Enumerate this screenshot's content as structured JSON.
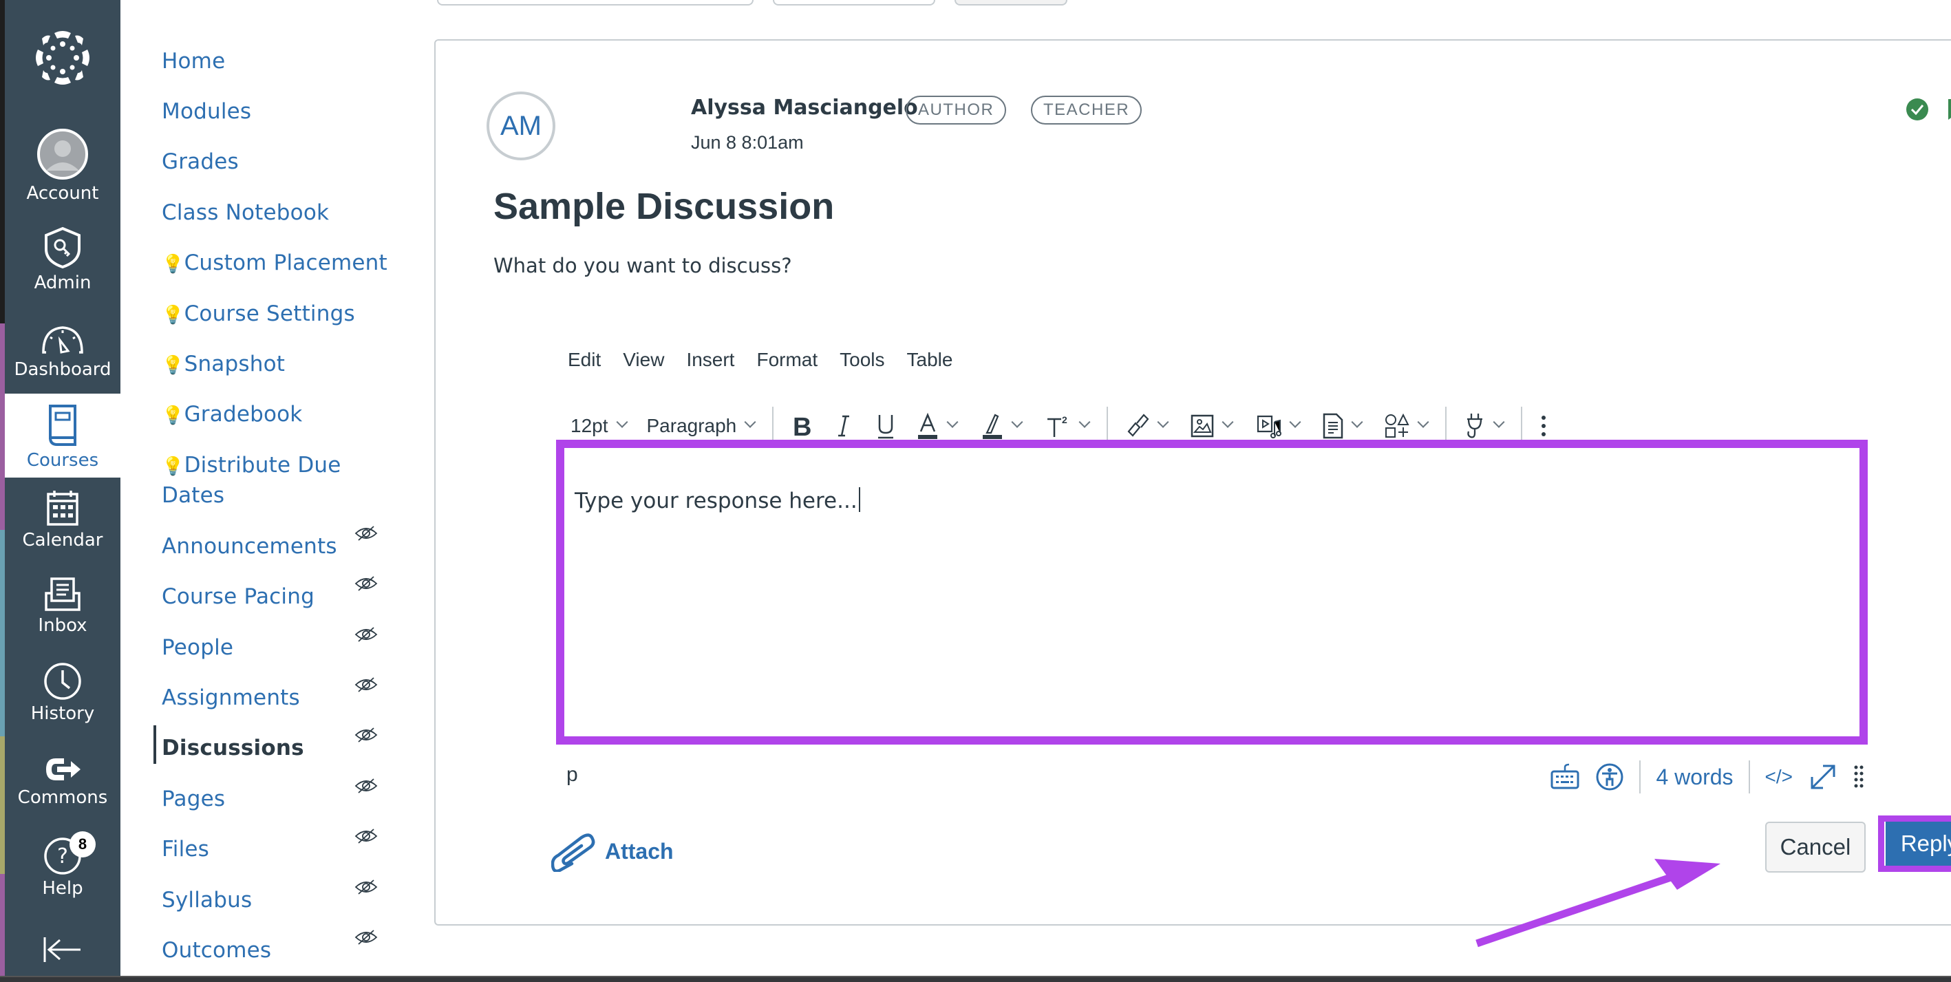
{
  "global_nav": {
    "items": [
      {
        "label": "Account",
        "icon": "account-avatar-icon"
      },
      {
        "label": "Admin",
        "icon": "admin-shield-key-icon"
      },
      {
        "label": "Dashboard",
        "icon": "dashboard-gauge-icon"
      },
      {
        "label": "Courses",
        "icon": "courses-book-icon",
        "active": true
      },
      {
        "label": "Calendar",
        "icon": "calendar-icon"
      },
      {
        "label": "Inbox",
        "icon": "inbox-icon"
      },
      {
        "label": "History",
        "icon": "clock-icon"
      },
      {
        "label": "Commons",
        "icon": "commons-icon"
      },
      {
        "label": "Help",
        "icon": "help-icon",
        "badge": "8"
      }
    ],
    "collapse_icon": "collapse-arrow-icon"
  },
  "course_nav": {
    "items": [
      {
        "label": "Home"
      },
      {
        "label": "Modules"
      },
      {
        "label": "Grades"
      },
      {
        "label": "Class Notebook"
      },
      {
        "label": "Custom Placement",
        "prefix": "💡"
      },
      {
        "label": "Course Settings",
        "prefix": "💡"
      },
      {
        "label": "Snapshot",
        "prefix": "💡"
      },
      {
        "label": "Gradebook",
        "prefix": "💡"
      },
      {
        "label": "Distribute Due",
        "label2": "Dates",
        "prefix": "💡"
      },
      {
        "label": "Announcements",
        "hidden": true
      },
      {
        "label": "Course Pacing",
        "hidden": true
      },
      {
        "label": "People",
        "hidden": true
      },
      {
        "label": "Assignments",
        "hidden": true
      },
      {
        "label": "Discussions",
        "hidden": true,
        "active": true
      },
      {
        "label": "Pages",
        "hidden": true
      },
      {
        "label": "Files",
        "hidden": true
      },
      {
        "label": "Syllabus",
        "hidden": true
      },
      {
        "label": "Outcomes",
        "hidden": true
      }
    ]
  },
  "post": {
    "avatar_initials": "AM",
    "author": "Alyssa Masciangelo",
    "badges": [
      "AUTHOR",
      "TEACHER"
    ],
    "date": "Jun 8 8:01am",
    "title": "Sample Discussion",
    "body": "What do you want to discuss?",
    "status_icons": [
      "read-check-icon",
      "bookmark-icon",
      "more-options-icon"
    ]
  },
  "editor": {
    "menu": [
      "Edit",
      "View",
      "Insert",
      "Format",
      "Tools",
      "Table"
    ],
    "font_size": "12pt",
    "block_format": "Paragraph",
    "content": "Type your response here...",
    "element_path": "p",
    "word_count": "4 words",
    "html_toggle": "</>"
  },
  "actions": {
    "attach": "Attach",
    "cancel": "Cancel",
    "reply": "Reply"
  },
  "annotation": {
    "highlight_color": "#b044ea"
  },
  "colors": {
    "brand": "#2d6fb1",
    "nav_bg": "#394b58",
    "text": "#2d3b45",
    "success": "#3a8a50"
  }
}
